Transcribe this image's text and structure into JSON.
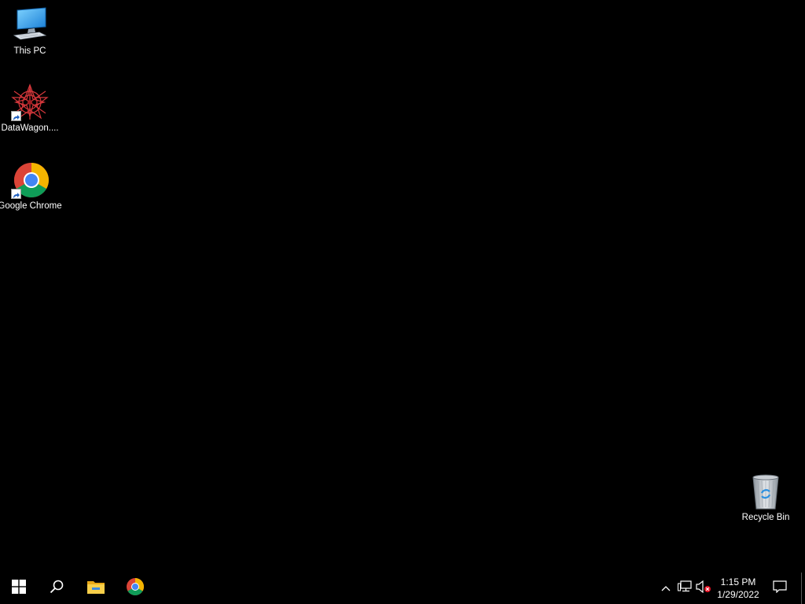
{
  "desktop": {
    "icons": [
      {
        "label": "This PC",
        "icon": "this-pc-icon",
        "shortcut": false
      },
      {
        "label": "DataWagon....",
        "icon": "datawagon-icon",
        "shortcut": true
      },
      {
        "label": "Google Chrome",
        "icon": "chrome-icon",
        "shortcut": true
      },
      {
        "label": "Recycle Bin",
        "icon": "recycle-bin-icon",
        "shortcut": false
      }
    ],
    "background_color": "#000000"
  },
  "taskbar": {
    "pinned": [
      {
        "icon": "windows-start-icon"
      },
      {
        "icon": "search-icon"
      },
      {
        "icon": "file-explorer-icon"
      },
      {
        "icon": "chrome-icon"
      }
    ],
    "tray": {
      "icons": [
        "chevron-up-icon",
        "network-icon",
        "volume-muted-icon"
      ],
      "time": "1:15 PM",
      "date": "1/29/2022",
      "notification_icon": "action-center-icon"
    },
    "background_color": "#000000"
  }
}
